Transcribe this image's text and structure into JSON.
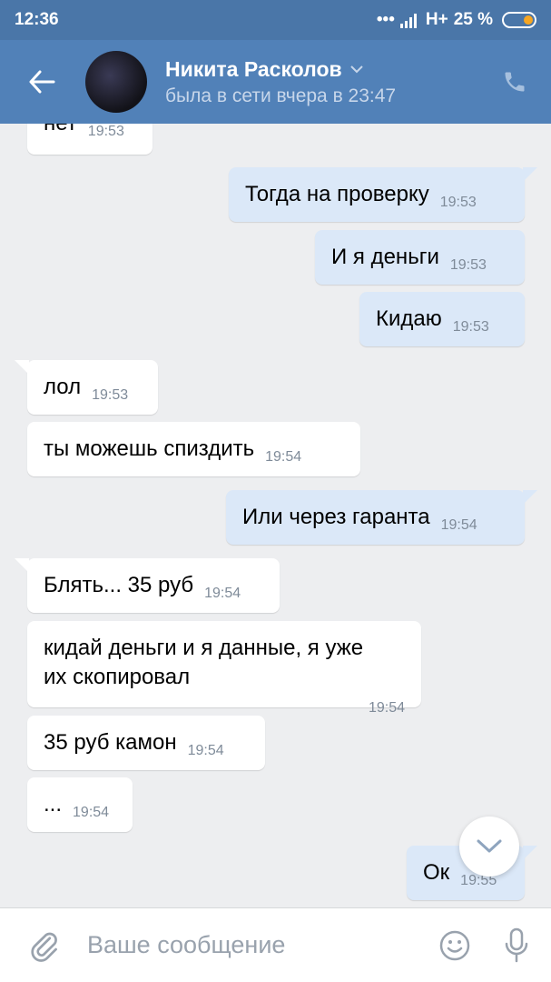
{
  "status_bar": {
    "time": "12:36",
    "network": "H+",
    "battery": "25 %"
  },
  "header": {
    "name": "Никита Расколов",
    "last_seen": "была в сети вчера в 23:47"
  },
  "messages": [
    {
      "dir": "in",
      "text": "нет",
      "time": "19:53"
    },
    {
      "dir": "out",
      "text": "Тогда на проверку",
      "time": "19:53"
    },
    {
      "dir": "out",
      "text": "И я деньги",
      "time": "19:53"
    },
    {
      "dir": "out",
      "text": "Кидаю",
      "time": "19:53"
    },
    {
      "dir": "in",
      "text": "лол",
      "time": "19:53"
    },
    {
      "dir": "in",
      "text": "ты можешь спиздить",
      "time": "19:54"
    },
    {
      "dir": "out",
      "text": "Или через гаранта",
      "time": "19:54"
    },
    {
      "dir": "in",
      "text": "Блять... 35 руб",
      "time": "19:54"
    },
    {
      "dir": "in",
      "text_line1": "кидай деньги и я данные, я уже",
      "text_line2": "их скопировал",
      "time": "19:54"
    },
    {
      "dir": "in",
      "text": "35 руб камон",
      "time": "19:54"
    },
    {
      "dir": "in",
      "text": "...",
      "time": "19:54"
    },
    {
      "dir": "out",
      "text": "Ок",
      "time": "19:55"
    }
  ],
  "composer": {
    "placeholder": "Ваше сообщение"
  },
  "colors": {
    "header": "#5181b8",
    "status_bar": "#4a76a8",
    "background": "#edeef0",
    "outgoing_bubble": "#dbe8f8",
    "incoming_bubble": "#ffffff"
  }
}
